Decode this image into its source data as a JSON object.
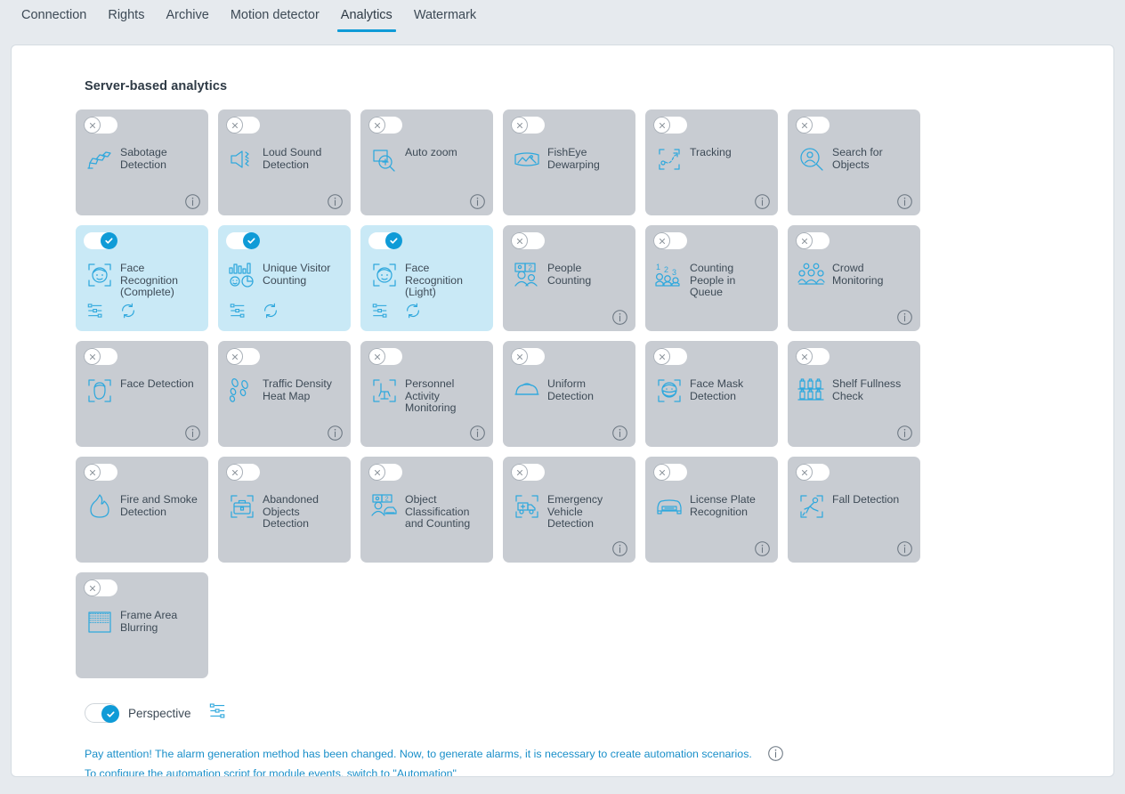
{
  "colors": {
    "accent": "#0f9bd7",
    "icon_blue": "#2fa8dd",
    "card_off_bg": "#c8ccd2",
    "card_on_bg": "#c9e9f6",
    "page_bg": "#e6eaee",
    "text": "#3d4a56",
    "notice_text": "#1a8fc9"
  },
  "tabs": [
    {
      "label": "Connection",
      "active": false
    },
    {
      "label": "Rights",
      "active": false
    },
    {
      "label": "Archive",
      "active": false
    },
    {
      "label": "Motion detector",
      "active": false
    },
    {
      "label": "Analytics",
      "active": true
    },
    {
      "label": "Watermark",
      "active": false
    }
  ],
  "section": {
    "title": "Server-based analytics"
  },
  "cards": [
    {
      "label": "Sabotage Detection",
      "enabled": false,
      "info": true,
      "icon": "sabotage-detection-icon"
    },
    {
      "label": "Loud Sound Detection",
      "enabled": false,
      "info": true,
      "icon": "loud-sound-icon"
    },
    {
      "label": "Auto zoom",
      "enabled": false,
      "info": true,
      "icon": "auto-zoom-icon"
    },
    {
      "label": "FishEye Dewarping",
      "enabled": false,
      "info": false,
      "icon": "fisheye-dewarping-icon"
    },
    {
      "label": "Tracking",
      "enabled": false,
      "info": true,
      "icon": "tracking-icon"
    },
    {
      "label": "Search for Objects",
      "enabled": false,
      "info": true,
      "icon": "search-objects-icon"
    },
    {
      "label": "Face Recognition (Complete)",
      "enabled": true,
      "info": false,
      "icon": "face-recognition-icon"
    },
    {
      "label": "Unique Visitor Counting",
      "enabled": true,
      "info": false,
      "icon": "unique-visitor-icon"
    },
    {
      "label": "Face Recognition (Light)",
      "enabled": true,
      "info": false,
      "icon": "face-recognition-icon"
    },
    {
      "label": "People Counting",
      "enabled": false,
      "info": true,
      "icon": "people-counting-icon"
    },
    {
      "label": "Counting People in Queue",
      "enabled": false,
      "info": false,
      "icon": "queue-counting-icon"
    },
    {
      "label": "Crowd Monitoring",
      "enabled": false,
      "info": true,
      "icon": "crowd-monitoring-icon"
    },
    {
      "label": "Face Detection",
      "enabled": false,
      "info": true,
      "icon": "face-detection-icon"
    },
    {
      "label": "Traffic Density Heat Map",
      "enabled": false,
      "info": true,
      "icon": "heat-map-icon"
    },
    {
      "label": "Personnel Activity Monitoring",
      "enabled": false,
      "info": true,
      "icon": "personnel-activity-icon"
    },
    {
      "label": "Uniform Detection",
      "enabled": false,
      "info": true,
      "icon": "uniform-detection-icon"
    },
    {
      "label": "Face Mask Detection",
      "enabled": false,
      "info": false,
      "icon": "face-mask-icon"
    },
    {
      "label": "Shelf Fullness Check",
      "enabled": false,
      "info": true,
      "icon": "shelf-fullness-icon"
    },
    {
      "label": "Fire and Smoke Detection",
      "enabled": false,
      "info": false,
      "icon": "fire-smoke-icon"
    },
    {
      "label": "Abandoned Objects Detection",
      "enabled": false,
      "info": false,
      "icon": "abandoned-objects-icon"
    },
    {
      "label": "Object Classification and Counting",
      "enabled": false,
      "info": false,
      "icon": "object-classification-icon"
    },
    {
      "label": "Emergency Vehicle Detection",
      "enabled": false,
      "info": true,
      "icon": "emergency-vehicle-icon"
    },
    {
      "label": "License Plate Recognition",
      "enabled": false,
      "info": true,
      "icon": "license-plate-icon"
    },
    {
      "label": "Fall Detection",
      "enabled": false,
      "info": true,
      "icon": "fall-detection-icon"
    },
    {
      "label": "Frame Area Blurring",
      "enabled": false,
      "info": false,
      "icon": "frame-blurring-icon"
    }
  ],
  "card_actions": {
    "settings_icon": "settings-sliders-icon",
    "refresh_icon": "refresh-icon"
  },
  "perspective": {
    "label": "Perspective",
    "enabled": true,
    "settings_icon": "settings-sliders-icon"
  },
  "notice": {
    "line1": "Pay attention! The alarm generation method has been changed. Now, to generate alarms, it is necessary to create automation scenarios.",
    "line2": "To configure the automation script for module events, switch to \"Automation\"",
    "info_icon": "info-icon"
  }
}
